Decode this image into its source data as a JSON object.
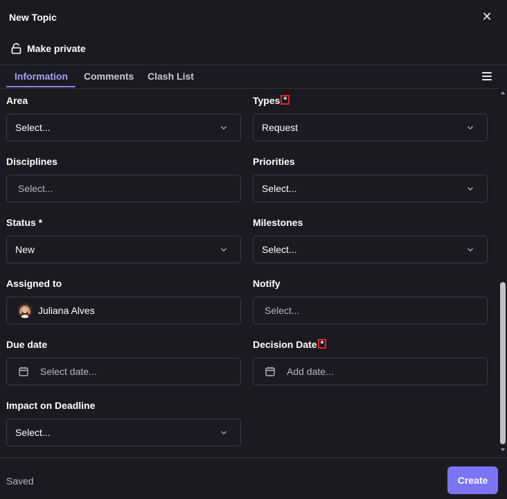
{
  "header": {
    "title": "New Topic",
    "make_private_label": "Make private"
  },
  "tabs": [
    {
      "label": "Information",
      "active": true
    },
    {
      "label": "Comments",
      "active": false
    },
    {
      "label": "Clash List",
      "active": false
    }
  ],
  "form": {
    "area": {
      "label": "Area",
      "placeholder": "Select..."
    },
    "types": {
      "label": "Types",
      "required_marker": "*",
      "value": "Request"
    },
    "disciplines": {
      "label": "Disciplines",
      "placeholder": "Select..."
    },
    "priorities": {
      "label": "Priorities",
      "placeholder": "Select..."
    },
    "status": {
      "label": "Status *",
      "value": "New"
    },
    "milestones": {
      "label": "Milestones",
      "placeholder": "Select..."
    },
    "assigned_to": {
      "label": "Assigned to",
      "value": "Juliana Alves"
    },
    "notify": {
      "label": "Notify",
      "placeholder": "Select..."
    },
    "due_date": {
      "label": "Due date",
      "placeholder": "Select date..."
    },
    "decision_date": {
      "label": "Decision Date",
      "required_marker": "*",
      "placeholder": "Add date..."
    },
    "impact_on_deadline": {
      "label": "Impact on Deadline",
      "placeholder": "Select..."
    }
  },
  "footer": {
    "status_text": "Saved",
    "create_label": "Create"
  },
  "colors": {
    "background": "#1b1a21",
    "accent": "#7b74f4",
    "active_tab": "#a6a2f5",
    "required_highlight": "#e0242b"
  }
}
